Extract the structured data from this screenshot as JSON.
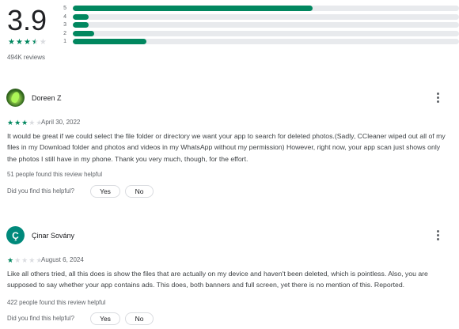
{
  "summary": {
    "rating": "3.9",
    "rating_value": 3.9,
    "review_count": "494K reviews",
    "distribution": [
      {
        "label": "5",
        "fraction": 0.62
      },
      {
        "label": "4",
        "fraction": 0.04
      },
      {
        "label": "3",
        "fraction": 0.04
      },
      {
        "label": "2",
        "fraction": 0.055
      },
      {
        "label": "1",
        "fraction": 0.19
      }
    ],
    "accent_color": "#01875f"
  },
  "reviews": [
    {
      "name": "Doreen Z",
      "avatar": "leaf-photo",
      "stars": 3,
      "date": "April 30, 2022",
      "text": "It would be great if we could select the file folder or directory we want your app to search for deleted photos.(Sadly, CCleaner wiped out all of my files in my Download folder and photos and videos in my WhatsApp without my permission) However, right now, your app scan just shows only the photos I still have in my phone. Thank you very much, though, for the effort.",
      "helpful_count": "51 people found this review helpful",
      "helpful_prompt": "Did you find this helpful?",
      "yes_label": "Yes",
      "no_label": "No"
    },
    {
      "name": "Çinar Sovány",
      "avatar_letter": "Ç",
      "avatar_color": "#00897b",
      "stars": 1,
      "date": "August 6, 2024",
      "text": "Like all others tried, all this does is show the files that are actually on my device and haven't been deleted, which is pointless. Also, you are supposed to say whether your app contains ads. This does, both banners and full screen, yet there is no mention of this. Reported.",
      "helpful_count": "422 people found this review helpful",
      "helpful_prompt": "Did you find this helpful?",
      "yes_label": "Yes",
      "no_label": "No"
    }
  ]
}
